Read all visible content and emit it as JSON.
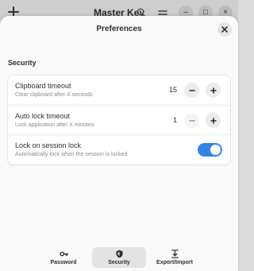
{
  "app": {
    "title": "Master Key",
    "add_icon": "plus-icon",
    "search_icon": "search-icon",
    "menu_icon": "hamburger-menu-icon",
    "minimize_label": "–",
    "maximize_label": "□",
    "close_label": "×"
  },
  "dialog": {
    "title": "Preferences",
    "close_icon": "close-icon"
  },
  "security": {
    "section_title": "Security",
    "rows": [
      {
        "label": "Clipboard timeout",
        "subtitle": "Clear clipboard after X seconds",
        "value": "15",
        "minus_enabled": true,
        "plus_enabled": true
      },
      {
        "label": "Auto lock timeout",
        "subtitle": "Lock application after X minutes",
        "value": "1",
        "minus_enabled": false,
        "plus_enabled": true
      },
      {
        "label": "Lock on session lock",
        "subtitle": "Automatically lock when the session is locked",
        "toggle_on": true
      }
    ]
  },
  "switcher": {
    "tabs": [
      {
        "label": "Password",
        "icon": "key-icon",
        "active": false
      },
      {
        "label": "Security",
        "icon": "shield-icon",
        "active": true
      },
      {
        "label": "Export/Import",
        "icon": "export-import-icon",
        "active": false
      }
    ]
  },
  "colors": {
    "accent": "#3584e4",
    "dialog_bg": "#fafafa",
    "card_bg": "#ffffff"
  }
}
